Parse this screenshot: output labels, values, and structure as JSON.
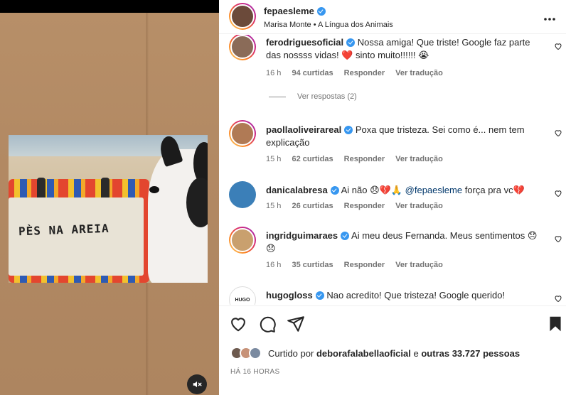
{
  "media": {
    "photo_caption_text": "PÈS NA AREIA",
    "mute_icon": "speaker-muted-icon"
  },
  "header": {
    "username": "fepaesleme",
    "verified": true,
    "music": "Marisa Monte • A Língua dos Animais",
    "more_icon": "more-horizontal-icon"
  },
  "comments": [
    {
      "username": "ferodriguesoficial",
      "verified": true,
      "text": "Nossa amiga! Que triste! Google faz parte das nossss vidas! ❤️ sinto muito!!!!!! 😭",
      "time": "16 h",
      "likes": "94 curtidas",
      "reply": "Responder",
      "translate": "Ver tradução",
      "view_replies": "Ver respostas (2)"
    },
    {
      "username": "paollaoliveirareal",
      "verified": true,
      "text": "Poxa que tristeza. Sei como é... nem tem explicação",
      "time": "15 h",
      "likes": "62 curtidas",
      "reply": "Responder",
      "translate": "Ver tradução"
    },
    {
      "username": "danicalabresa",
      "verified": true,
      "text_before": "Ai não 😞💔🙏",
      "mention": "@fepaesleme",
      "text_after": "força pra vc💔",
      "time": "15 h",
      "likes": "26 curtidas",
      "reply": "Responder",
      "translate": "Ver tradução"
    },
    {
      "username": "ingridguimaraes",
      "verified": true,
      "text": "Ai meu deus Fernanda. Meus sentimentos 😞😞",
      "time": "16 h",
      "likes": "35 curtidas",
      "reply": "Responder",
      "translate": "Ver tradução"
    },
    {
      "username": "hugogloss",
      "verified": true,
      "text": "Nao acredito! Que tristeza! Google querido!",
      "avatar_text": "HUGO"
    }
  ],
  "actions": {
    "like_icon": "heart-icon",
    "comment_icon": "comment-icon",
    "share_icon": "send-icon",
    "save_icon": "bookmark-icon",
    "liked_by_prefix": "Curtido por",
    "liked_by_user": "deborafalabellaoficial",
    "liked_by_and": "e",
    "liked_by_others": "outras 33.727 pessoas",
    "time_ago": "HÁ 16 HORAS"
  },
  "colors": {
    "verified_blue": "#3797f0",
    "text": "#262626",
    "meta_gray": "#737373",
    "mention": "#00376b"
  }
}
